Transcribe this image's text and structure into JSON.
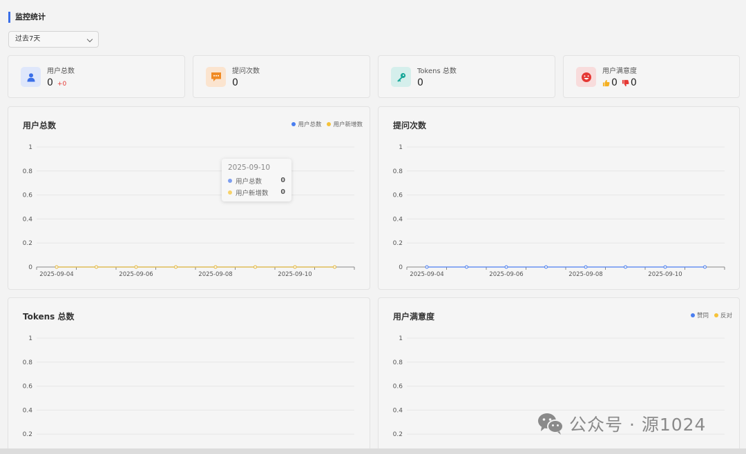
{
  "header": {
    "title": "监控统计"
  },
  "filter": {
    "selected": "过去7天"
  },
  "stats": {
    "users": {
      "label": "用户总数",
      "value": "0",
      "delta": "+0"
    },
    "questions": {
      "label": "提问次数",
      "value": "0"
    },
    "tokens": {
      "label": "Tokens 总数",
      "value": "0"
    },
    "satisfaction": {
      "label": "用户满意度",
      "likes": "0",
      "dislikes": "0"
    }
  },
  "colors": {
    "accent": "#3b6fe8",
    "blue": "#4a7ef0",
    "yellow": "#f5c239",
    "red": "#e53935",
    "orange": "#f08a24",
    "teal": "#1aa89a"
  },
  "charts": {
    "users": {
      "title": "用户总数",
      "legend": [
        "用户总数",
        "用户新增数"
      ]
    },
    "questions": {
      "title": "提问次数"
    },
    "tokens": {
      "title": "Tokens 总数"
    },
    "satisfaction": {
      "title": "用户满意度",
      "legend": [
        "赞同",
        "反对"
      ]
    }
  },
  "tooltip": {
    "date": "2025-09-10",
    "rows": [
      {
        "name": "用户总数",
        "value": "0"
      },
      {
        "name": "用户新增数",
        "value": "0"
      }
    ]
  },
  "watermark": {
    "text": "公众号 · 源1024"
  },
  "chart_data": [
    {
      "type": "line",
      "title": "用户总数",
      "x": [
        "2025-09-04",
        "2025-09-05",
        "2025-09-06",
        "2025-09-07",
        "2025-09-08",
        "2025-09-09",
        "2025-09-10",
        "2025-09-11"
      ],
      "x_tick_labels": [
        "2025-09-04",
        "2025-09-06",
        "2025-09-08",
        "2025-09-10"
      ],
      "y_ticks": [
        "0",
        "0.2",
        "0.4",
        "0.6",
        "0.8",
        "1"
      ],
      "ylim": [
        0,
        1
      ],
      "series": [
        {
          "name": "用户总数",
          "color": "#4a7ef0",
          "values": [
            0,
            0,
            0,
            0,
            0,
            0,
            0,
            0
          ]
        },
        {
          "name": "用户新增数",
          "color": "#f5c239",
          "values": [
            0,
            0,
            0,
            0,
            0,
            0,
            0,
            0
          ]
        }
      ],
      "legend": "top-right"
    },
    {
      "type": "line",
      "title": "提问次数",
      "x": [
        "2025-09-04",
        "2025-09-05",
        "2025-09-06",
        "2025-09-07",
        "2025-09-08",
        "2025-09-09",
        "2025-09-10",
        "2025-09-11"
      ],
      "x_tick_labels": [
        "2025-09-04",
        "2025-09-06",
        "2025-09-08",
        "2025-09-10"
      ],
      "y_ticks": [
        "0",
        "0.2",
        "0.4",
        "0.6",
        "0.8",
        "1"
      ],
      "ylim": [
        0,
        1
      ],
      "series": [
        {
          "color": "#4a7ef0",
          "values": [
            0,
            0,
            0,
            0,
            0,
            0,
            0,
            0
          ]
        }
      ]
    },
    {
      "type": "line",
      "title": "Tokens 总数",
      "y_ticks": [
        "0.2",
        "0.4",
        "0.6",
        "0.8",
        "1"
      ],
      "ylim": [
        0,
        1
      ],
      "series": []
    },
    {
      "type": "line",
      "title": "用户满意度",
      "y_ticks": [
        "0.2",
        "0.4",
        "0.6",
        "0.8",
        "1"
      ],
      "ylim": [
        0,
        1
      ],
      "series": [
        {
          "name": "赞同",
          "color": "#4a7ef0",
          "values": []
        },
        {
          "name": "反对",
          "color": "#f5c239",
          "values": []
        }
      ],
      "legend": "top-right"
    }
  ]
}
